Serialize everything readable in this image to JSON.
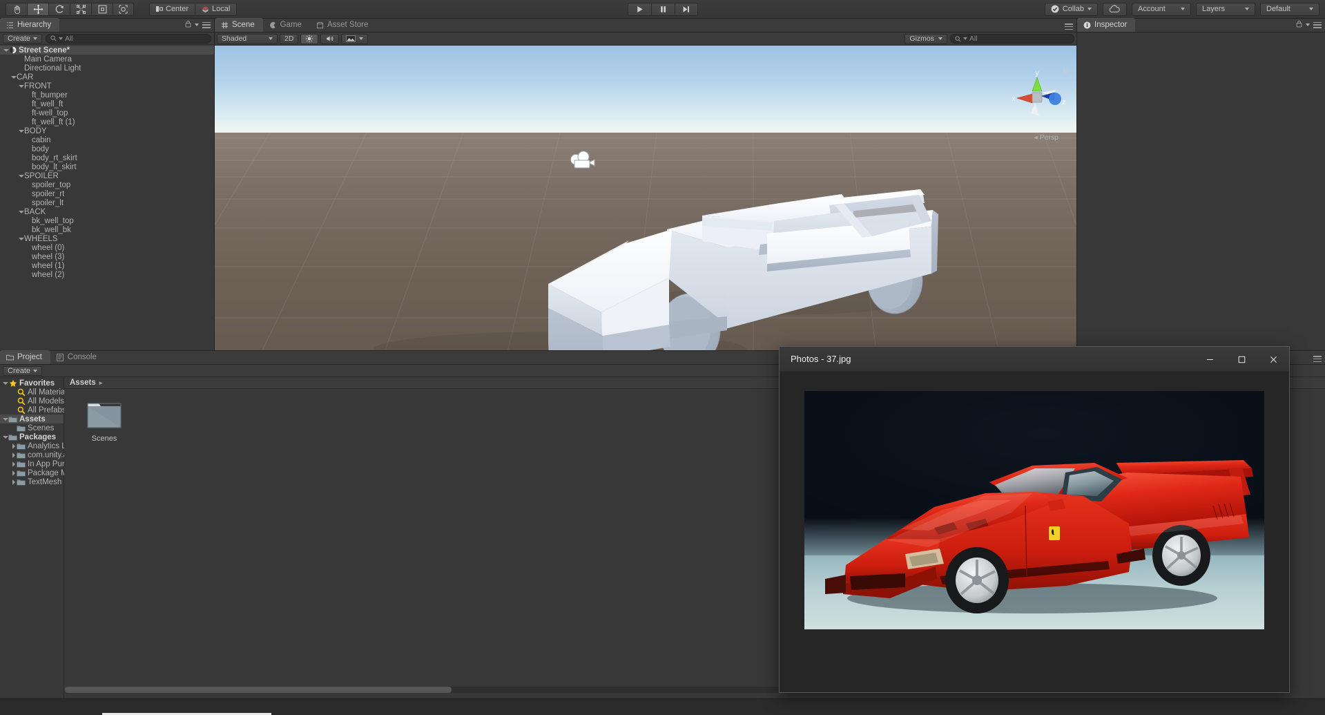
{
  "toolbar": {
    "tools": [
      {
        "name": "hand-tool",
        "active": false
      },
      {
        "name": "move-tool",
        "active": true
      },
      {
        "name": "rotate-tool",
        "active": false
      },
      {
        "name": "scale-tool",
        "active": false
      },
      {
        "name": "rect-tool",
        "active": false
      },
      {
        "name": "transform-tool",
        "active": false
      }
    ],
    "pivot_label": "Center",
    "space_label": "Local",
    "play_label": "play",
    "pause_label": "pause",
    "step_label": "step",
    "collab_label": "Collab",
    "cloud_label": "cloud-services",
    "account_label": "Account",
    "layers_label": "Layers",
    "layout_label": "Default"
  },
  "hierarchy": {
    "tab_label": "Hierarchy",
    "create_label": "Create",
    "search_placeholder": "All",
    "items": [
      {
        "label": "Street Scene*",
        "indent": 0,
        "arrow": "open",
        "bold": true,
        "scene": true,
        "selected": true
      },
      {
        "label": "Main Camera",
        "indent": 2,
        "arrow": "none",
        "bold": false
      },
      {
        "label": "Directional Light",
        "indent": 2,
        "arrow": "none",
        "bold": false
      },
      {
        "label": "CAR",
        "indent": 1,
        "arrow": "open",
        "bold": false
      },
      {
        "label": "FRONT",
        "indent": 2,
        "arrow": "open",
        "bold": false
      },
      {
        "label": "ft_bumper",
        "indent": 3,
        "arrow": "none",
        "bold": false
      },
      {
        "label": "ft_well_ft",
        "indent": 3,
        "arrow": "none",
        "bold": false
      },
      {
        "label": "ft-well_top",
        "indent": 3,
        "arrow": "none",
        "bold": false
      },
      {
        "label": "ft_well_ft (1)",
        "indent": 3,
        "arrow": "none",
        "bold": false
      },
      {
        "label": "BODY",
        "indent": 2,
        "arrow": "open",
        "bold": false
      },
      {
        "label": "cabin",
        "indent": 3,
        "arrow": "none",
        "bold": false
      },
      {
        "label": "body",
        "indent": 3,
        "arrow": "none",
        "bold": false
      },
      {
        "label": "body_rt_skirt",
        "indent": 3,
        "arrow": "none",
        "bold": false
      },
      {
        "label": "body_lt_skirt",
        "indent": 3,
        "arrow": "none",
        "bold": false
      },
      {
        "label": "SPOILER",
        "indent": 2,
        "arrow": "open",
        "bold": false
      },
      {
        "label": "spoiler_top",
        "indent": 3,
        "arrow": "none",
        "bold": false
      },
      {
        "label": "spoiler_rt",
        "indent": 3,
        "arrow": "none",
        "bold": false
      },
      {
        "label": "spoiler_lt",
        "indent": 3,
        "arrow": "none",
        "bold": false
      },
      {
        "label": "BACK",
        "indent": 2,
        "arrow": "open",
        "bold": false
      },
      {
        "label": "bk_well_top",
        "indent": 3,
        "arrow": "none",
        "bold": false
      },
      {
        "label": "bk_well_bk",
        "indent": 3,
        "arrow": "none",
        "bold": false
      },
      {
        "label": "WHEELS",
        "indent": 2,
        "arrow": "open",
        "bold": false
      },
      {
        "label": "wheel (0)",
        "indent": 3,
        "arrow": "none",
        "bold": false
      },
      {
        "label": "wheel (3)",
        "indent": 3,
        "arrow": "none",
        "bold": false
      },
      {
        "label": "wheel (1)",
        "indent": 3,
        "arrow": "none",
        "bold": false
      },
      {
        "label": "wheel (2)",
        "indent": 3,
        "arrow": "none",
        "bold": false
      }
    ]
  },
  "scene": {
    "tabs": [
      {
        "label": "Scene",
        "icon": "grid-icon",
        "active": true
      },
      {
        "label": "Game",
        "icon": "gamepad-icon",
        "active": false
      },
      {
        "label": "Asset Store",
        "icon": "store-icon",
        "active": false
      }
    ],
    "shading_label": "Shaded",
    "mode_2d_label": "2D",
    "lighting_label": "lighting-toggle",
    "audio_label": "audio-toggle",
    "fx_label": "effects-toggle",
    "gizmos_label": "Gizmos",
    "search_placeholder": "All",
    "projection_label": "Persp",
    "axis_x": "x",
    "axis_y": "y",
    "axis_z": "z",
    "colors": {
      "sky_top": "#9cc3e5",
      "horizon": "#eef5f3",
      "ground": "#6e6257",
      "model": "#e8ecf2"
    }
  },
  "inspector": {
    "tab_label": "Inspector"
  },
  "project": {
    "tabs": [
      {
        "label": "Project",
        "icon": "folder-icon",
        "active": true
      },
      {
        "label": "Console",
        "icon": "console-icon",
        "active": false
      }
    ],
    "create_label": "Create",
    "breadcrumb": "Assets",
    "tree": [
      {
        "label": "Favorites",
        "indent": 0,
        "arrow": "open",
        "icon": "star",
        "bold": true
      },
      {
        "label": "All Materials",
        "indent": 1,
        "arrow": "none",
        "icon": "search",
        "bold": false
      },
      {
        "label": "All Models",
        "indent": 1,
        "arrow": "none",
        "icon": "search",
        "bold": false
      },
      {
        "label": "All Prefabs",
        "indent": 1,
        "arrow": "none",
        "icon": "search",
        "bold": false
      },
      {
        "label": "Assets",
        "indent": 0,
        "arrow": "open",
        "icon": "folder",
        "bold": true,
        "selected": true
      },
      {
        "label": "Scenes",
        "indent": 1,
        "arrow": "none",
        "icon": "folder",
        "bold": false
      },
      {
        "label": "Packages",
        "indent": 0,
        "arrow": "open",
        "icon": "folder",
        "bold": true
      },
      {
        "label": "Analytics Lib",
        "indent": 1,
        "arrow": "closed",
        "icon": "folder",
        "bold": false
      },
      {
        "label": "com.unity.a",
        "indent": 1,
        "arrow": "closed",
        "icon": "folder",
        "bold": false
      },
      {
        "label": "In App Purc",
        "indent": 1,
        "arrow": "closed",
        "icon": "folder",
        "bold": false
      },
      {
        "label": "Package Ma",
        "indent": 1,
        "arrow": "closed",
        "icon": "folder",
        "bold": false
      },
      {
        "label": "TextMesh P",
        "indent": 1,
        "arrow": "closed",
        "icon": "folder",
        "bold": false
      }
    ],
    "assets": [
      {
        "label": "Scenes",
        "type": "folder"
      }
    ]
  },
  "photos_window": {
    "title": "Photos - 37.jpg",
    "minimize_label": "minimize",
    "maximize_label": "maximize",
    "close_label": "close",
    "image_alt": "red Ferrari F40 sports car on studio backdrop"
  }
}
